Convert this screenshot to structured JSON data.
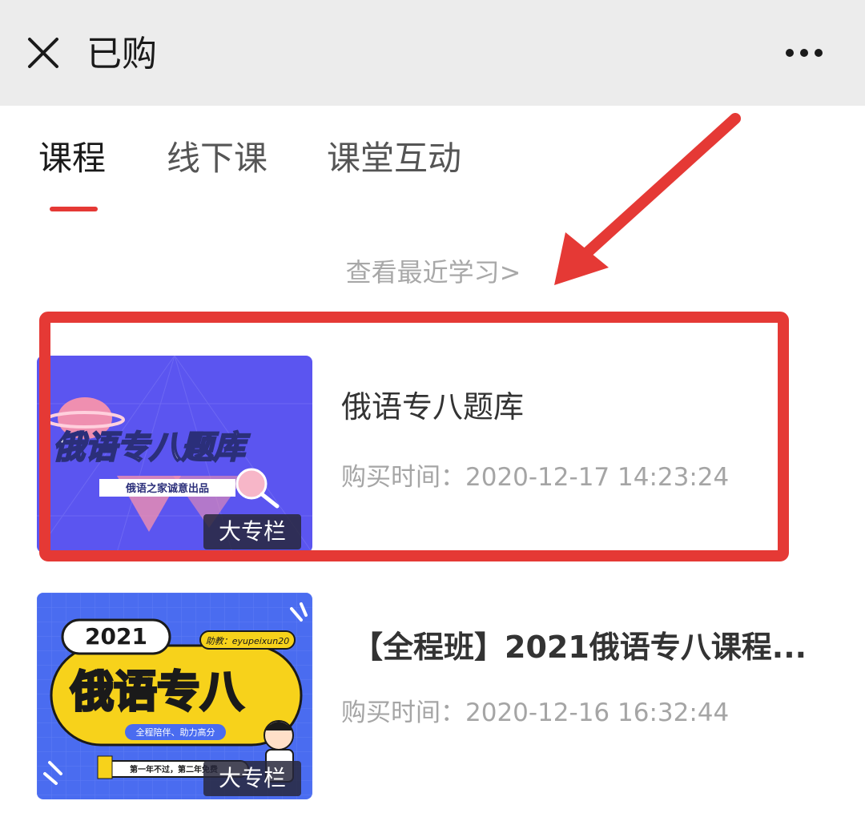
{
  "titlebar": {
    "title": "已购",
    "close_icon": "close-icon",
    "more_icon": "more-horizontal-icon"
  },
  "tabs": [
    {
      "label": "课程",
      "active": true
    },
    {
      "label": "线下课",
      "active": false
    },
    {
      "label": "课堂互动",
      "active": false
    }
  ],
  "recent_link": "查看最近学习>",
  "courses": [
    {
      "title": "俄语专八题库",
      "purchase_time": "购买时间：2020-12-17 14:23:24",
      "badge": "大专栏",
      "thumb": {
        "headline": "俄语专八题库",
        "tagline": "俄语之家诚意出品"
      }
    },
    {
      "title": "【全程班】2021俄语专八课程...",
      "purchase_time": "购买时间：2020-12-16 16:32:44",
      "badge": "大专栏",
      "thumb": {
        "year": "2021",
        "headline": "俄语专八",
        "handle": "助教：eyupeixun20",
        "tagline": "全程陪伴、助力高分",
        "footer": "第一年不过，第二年免费"
      }
    }
  ],
  "colors": {
    "accent": "#e53935",
    "titlebar_bg": "#ececec",
    "thumb1_bg": "#5b55f0",
    "thumb2_bg": "#4a6cf0",
    "thumb2_banner": "#f7d21b"
  }
}
